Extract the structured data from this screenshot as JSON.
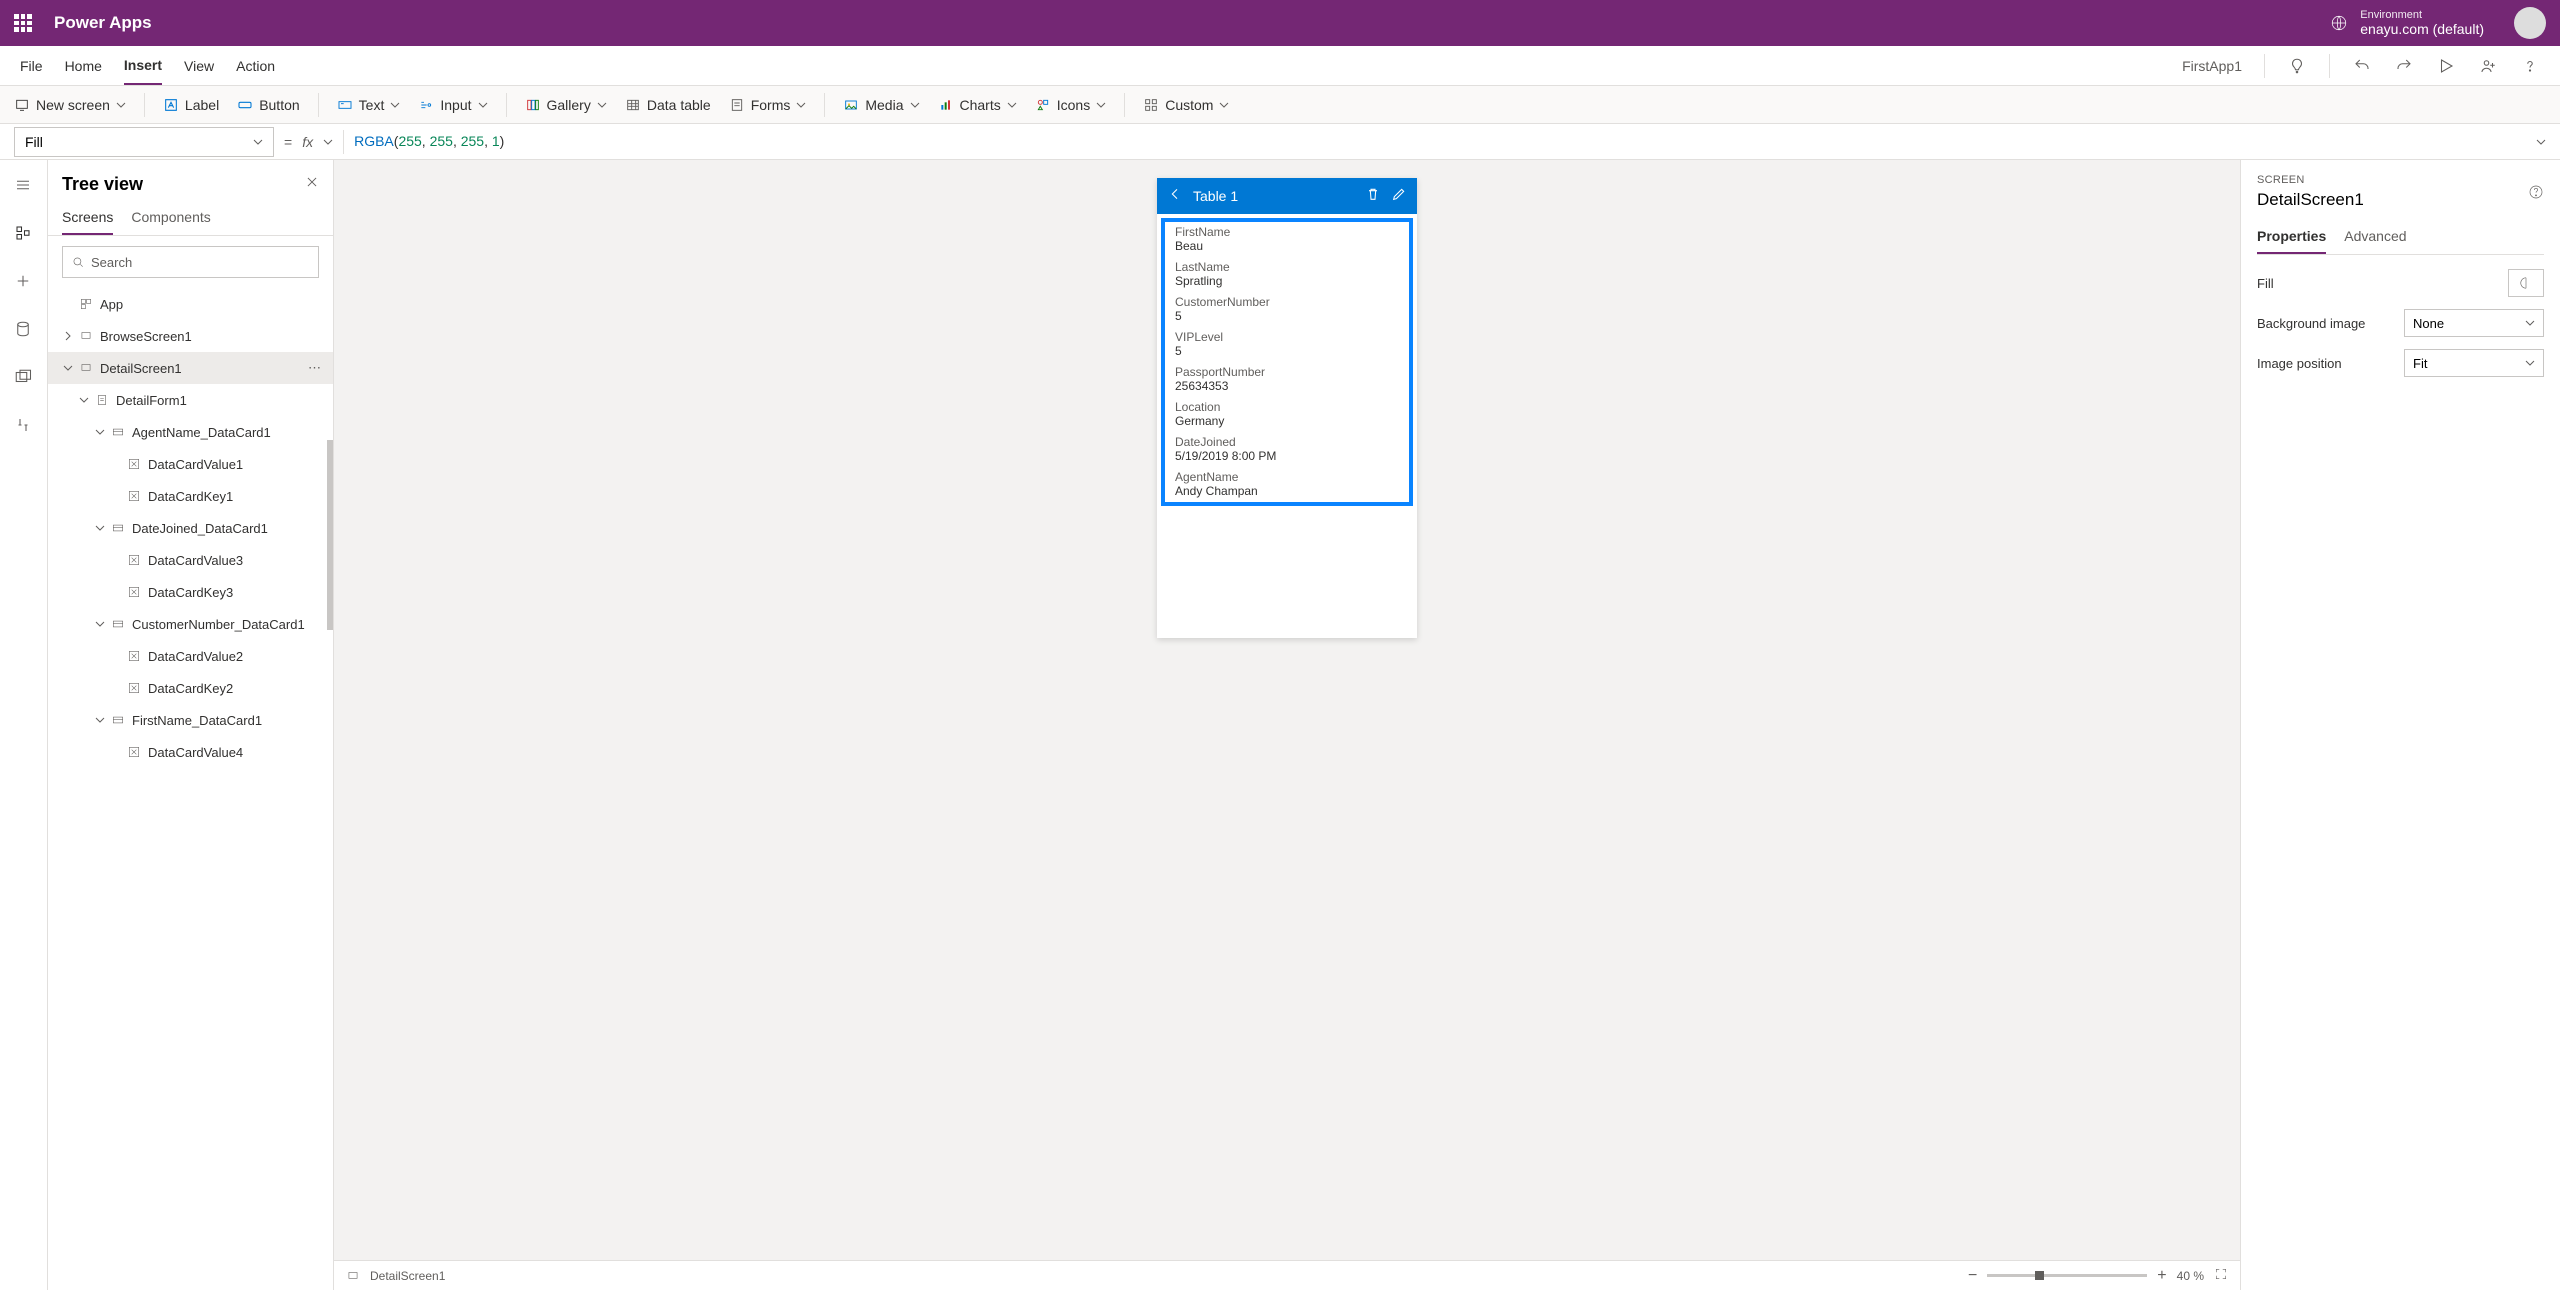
{
  "titlebar": {
    "product": "Power Apps",
    "env_label": "Environment",
    "env_value": "enayu.com (default)"
  },
  "menubar": {
    "items": [
      "File",
      "Home",
      "Insert",
      "View",
      "Action"
    ],
    "active_index": 2,
    "app_name": "FirstApp1"
  },
  "ribbon": {
    "new_screen": "New screen",
    "label": "Label",
    "button": "Button",
    "text": "Text",
    "input": "Input",
    "gallery": "Gallery",
    "data_table": "Data table",
    "forms": "Forms",
    "media": "Media",
    "charts": "Charts",
    "icons": "Icons",
    "custom": "Custom"
  },
  "formula": {
    "property": "Fill",
    "expression_fn": "RGBA",
    "expression_args": [
      "255",
      "255",
      "255",
      "1"
    ]
  },
  "tree": {
    "title": "Tree view",
    "tabs": [
      "Screens",
      "Components"
    ],
    "active_tab": 0,
    "search_placeholder": "Search",
    "items": [
      {
        "indent": 0,
        "icon": "app",
        "label": "App",
        "expand": ""
      },
      {
        "indent": 0,
        "icon": "screen",
        "label": "BrowseScreen1",
        "expand": "right"
      },
      {
        "indent": 0,
        "icon": "screen",
        "label": "DetailScreen1",
        "expand": "down",
        "sel": true,
        "more": true
      },
      {
        "indent": 1,
        "icon": "form",
        "label": "DetailForm1",
        "expand": "down"
      },
      {
        "indent": 2,
        "icon": "card",
        "label": "AgentName_DataCard1",
        "expand": "down"
      },
      {
        "indent": 3,
        "icon": "ctrl",
        "label": "DataCardValue1",
        "expand": ""
      },
      {
        "indent": 3,
        "icon": "ctrl",
        "label": "DataCardKey1",
        "expand": ""
      },
      {
        "indent": 2,
        "icon": "card",
        "label": "DateJoined_DataCard1",
        "expand": "down"
      },
      {
        "indent": 3,
        "icon": "ctrl",
        "label": "DataCardValue3",
        "expand": ""
      },
      {
        "indent": 3,
        "icon": "ctrl",
        "label": "DataCardKey3",
        "expand": ""
      },
      {
        "indent": 2,
        "icon": "card",
        "label": "CustomerNumber_DataCard1",
        "expand": "down"
      },
      {
        "indent": 3,
        "icon": "ctrl",
        "label": "DataCardValue2",
        "expand": ""
      },
      {
        "indent": 3,
        "icon": "ctrl",
        "label": "DataCardKey2",
        "expand": ""
      },
      {
        "indent": 2,
        "icon": "card",
        "label": "FirstName_DataCard1",
        "expand": "down"
      },
      {
        "indent": 3,
        "icon": "ctrl",
        "label": "DataCardValue4",
        "expand": ""
      }
    ]
  },
  "canvas": {
    "header_title": "Table 1",
    "fields": [
      {
        "k": "FirstName",
        "v": "Beau"
      },
      {
        "k": "LastName",
        "v": "Spratling"
      },
      {
        "k": "CustomerNumber",
        "v": "5"
      },
      {
        "k": "VIPLevel",
        "v": "5"
      },
      {
        "k": "PassportNumber",
        "v": "25634353"
      },
      {
        "k": "Location",
        "v": "Germany"
      },
      {
        "k": "DateJoined",
        "v": "5/19/2019 8:00 PM"
      },
      {
        "k": "AgentName",
        "v": "Andy Champan"
      }
    ],
    "footer_screen": "DetailScreen1",
    "zoom": "40  %"
  },
  "props": {
    "section": "SCREEN",
    "name": "DetailScreen1",
    "tabs": [
      "Properties",
      "Advanced"
    ],
    "active_tab": 0,
    "rows": {
      "fill": "Fill",
      "bgimg": "Background image",
      "bgimg_val": "None",
      "imgpos": "Image position",
      "imgpos_val": "Fit"
    }
  }
}
